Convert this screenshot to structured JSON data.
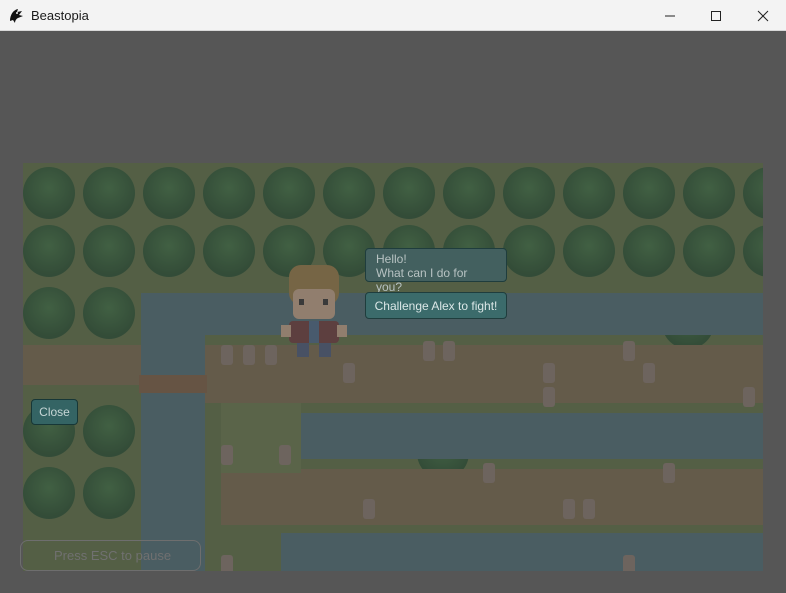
{
  "window": {
    "title": "Beastopia",
    "app_icon": "dragon-icon",
    "controls": [
      "minimize-icon",
      "maximize-icon",
      "close-icon"
    ]
  },
  "dialog": {
    "npc_name": "Alex",
    "greeting": [
      "Hello!",
      "What can I do for you?"
    ],
    "options": [
      "Challenge Alex to fight!"
    ],
    "close_label": "Close"
  },
  "hint": {
    "text": "Press ESC to pause"
  },
  "colors": {
    "button_bg": "#3b6b6b",
    "overlay": "#464646",
    "grass": "#5f7346",
    "water": "#4f6e78"
  }
}
